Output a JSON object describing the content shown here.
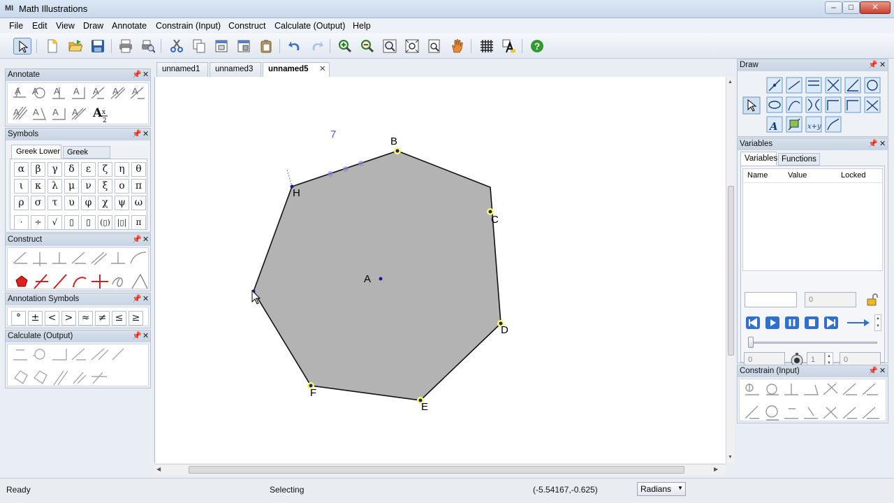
{
  "window": {
    "title": "Math Illustrations",
    "app_icon_text": "MI"
  },
  "menu": [
    "File",
    "Edit",
    "View",
    "Draw",
    "Annotate",
    "Constrain (Input)",
    "Construct",
    "Calculate (Output)",
    "Help"
  ],
  "toolbar_icons": [
    "select-arrow-icon",
    "new-document-icon",
    "open-folder-icon",
    "save-disk-icon",
    "print-icon",
    "print-preview-icon",
    "cut-scissors-icon",
    "copy-icon",
    "paste-special-icon",
    "paste-format-icon",
    "clipboard-paste-icon",
    "undo-icon",
    "redo-icon",
    "zoom-in-icon",
    "zoom-out-icon",
    "zoom-fit-icon",
    "zoom-page-icon",
    "zoom-selection-icon",
    "pan-hand-icon",
    "grid-icon",
    "font-icon",
    "help-icon"
  ],
  "panels": {
    "annotate": {
      "title": "Annotate"
    },
    "symbols": {
      "title": "Symbols",
      "tabs": [
        "Greek Lower",
        "Greek Upper"
      ],
      "rows": [
        [
          "α",
          "β",
          "γ",
          "δ",
          "ε",
          "ζ",
          "η",
          "θ"
        ],
        [
          "ι",
          "κ",
          "λ",
          "μ",
          "ν",
          "ξ",
          "ο",
          "π"
        ],
        [
          "ρ",
          "σ",
          "τ",
          "υ",
          "φ",
          "χ",
          "ψ",
          "ω"
        ],
        [
          "·",
          "÷",
          "√",
          "▯",
          "▯",
          "(▯)",
          "|▯|",
          "π"
        ]
      ]
    },
    "construct": {
      "title": "Construct"
    },
    "annotation_symbols": {
      "title": "Annotation Symbols",
      "items": [
        "°",
        "±",
        "<",
        ">",
        "≈",
        "≠",
        "≤",
        "≥"
      ]
    },
    "calculate": {
      "title": "Calculate (Output)"
    },
    "draw": {
      "title": "Draw"
    },
    "variables": {
      "title": "Variables",
      "tabs": [
        "Variables",
        "Functions"
      ],
      "columns": [
        "Name",
        "Value",
        "Locked"
      ],
      "value_field": "0",
      "start_field": "0",
      "step_field": "1",
      "end_field": "0"
    },
    "constrain": {
      "title": "Constrain (Input)"
    }
  },
  "doc_tabs": [
    "unnamed1",
    "unnamed3",
    "unnamed5"
  ],
  "active_tab": "unnamed5",
  "canvas": {
    "floating_label": "7",
    "vertex_labels": {
      "A": "A",
      "B": "B",
      "C": "C",
      "D": "D",
      "E": "E",
      "F": "F",
      "H": "H"
    }
  },
  "status": {
    "state": "Ready",
    "mode": "Selecting",
    "coordinates": "(-5.54167,-0.625)",
    "angle_unit": "Radians"
  },
  "colors": {
    "polygon_fill": "#b3b3b3",
    "point": "#1c1c8a",
    "point_highlight": "#ffff66",
    "label_seven": "#5a5aa8"
  }
}
